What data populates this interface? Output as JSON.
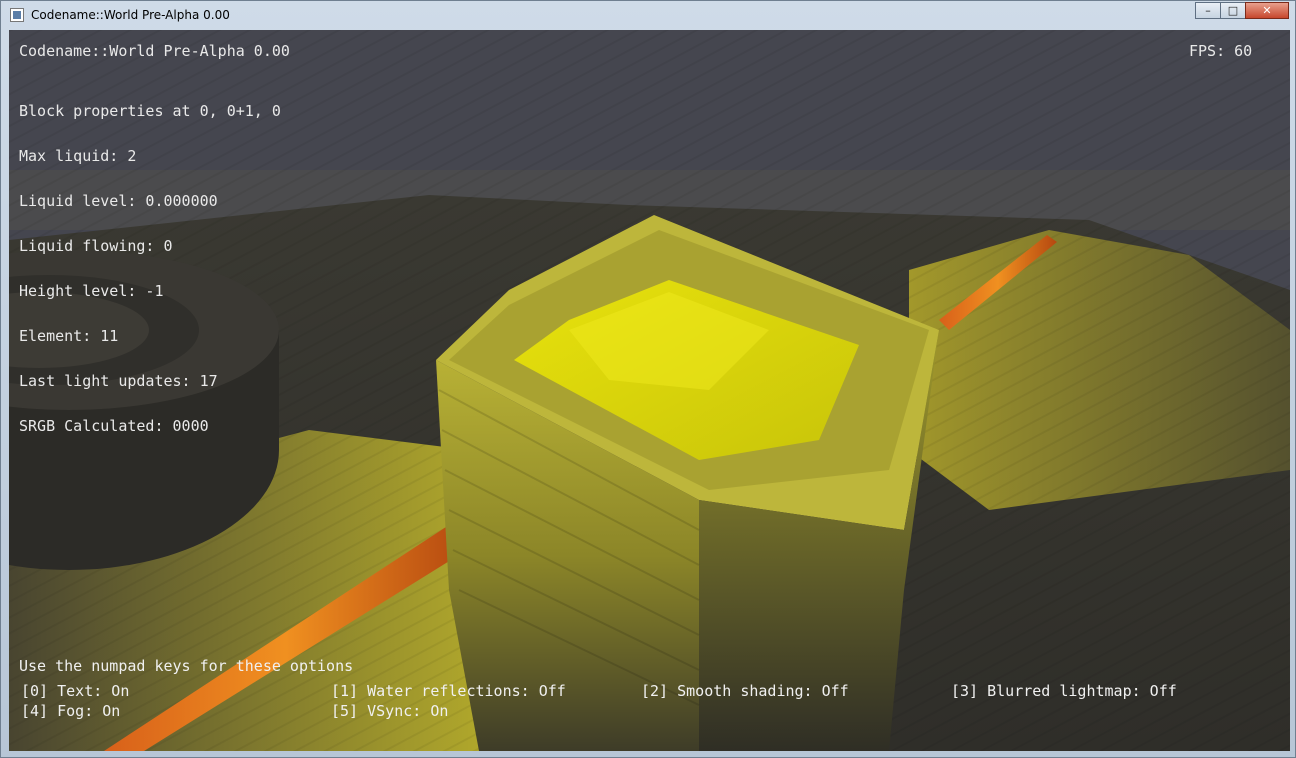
{
  "window": {
    "title": "Codename::World Pre-Alpha 0.00",
    "controls": {
      "minimize": "–",
      "maximize": "□",
      "close": "✕"
    }
  },
  "hud": {
    "title": "Codename::World Pre-Alpha 0.00",
    "fps": "FPS: 60",
    "block_header": "Block properties at 0, 0+1, 0",
    "properties": [
      "Max liquid: 2",
      "Liquid level: 0.000000",
      "Liquid flowing: 0",
      "Height level: -1",
      "Element: 11",
      "Last light updates: 17",
      "SRGB Calculated: 0000"
    ]
  },
  "options": {
    "hint": "Use the numpad keys for these options",
    "items": [
      "[0] Text: On",
      "[1] Water reflections: Off",
      "[2] Smooth shading: Off",
      "[3] Blurred lightmap: Off",
      "[4] Fog: On",
      "[5] VSync: On"
    ]
  },
  "colors": {
    "sky": "#45464f",
    "ground": "#3d3a30",
    "liquid": "#d8d20a",
    "lava": "#c8651a",
    "block": "#a8a230"
  }
}
